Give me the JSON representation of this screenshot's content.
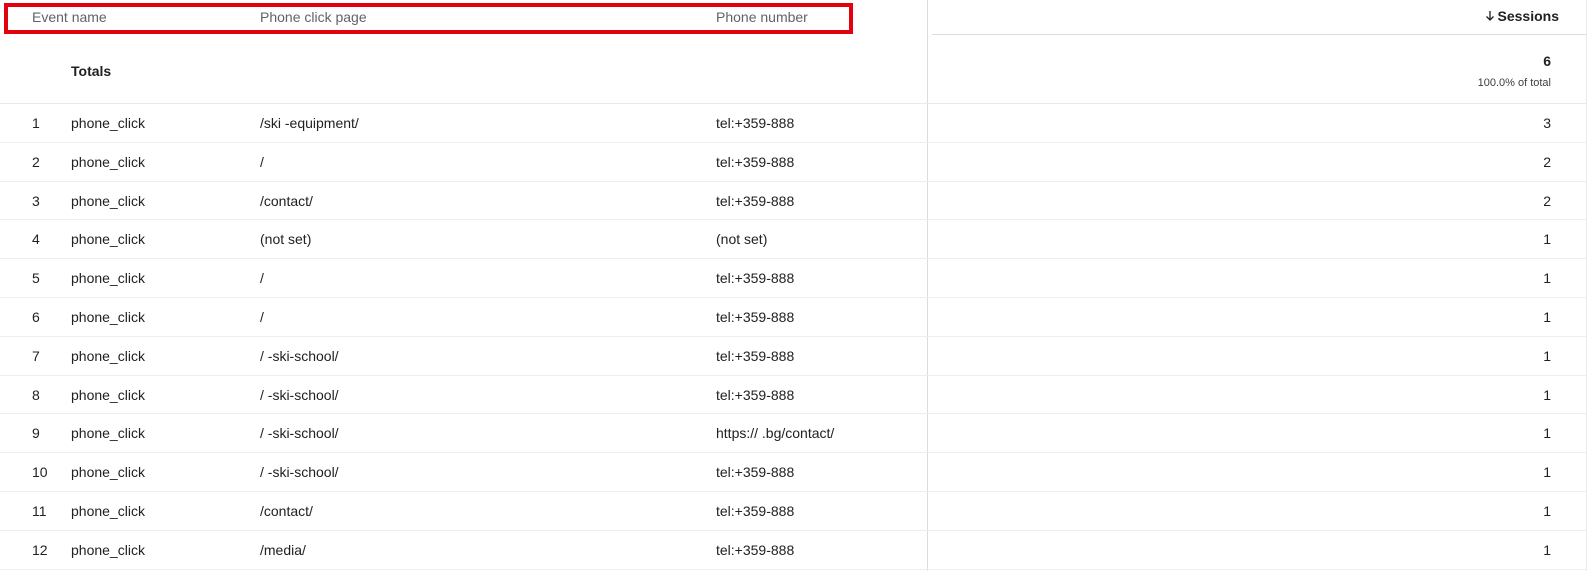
{
  "header": {
    "event_name": "Event name",
    "phone_click_page": "Phone click page",
    "phone_number": "Phone number",
    "sessions": "Sessions",
    "sort_icon": "arrow-down-icon"
  },
  "totals": {
    "label": "Totals",
    "value": "6",
    "percent": "100.0% of total"
  },
  "rows": [
    {
      "index": "1",
      "event": "phone_click",
      "page": "/ski              -equipment/",
      "phone": "tel:+359-888",
      "sessions": "3"
    },
    {
      "index": "2",
      "event": "phone_click",
      "page": "/",
      "phone": "tel:+359-888",
      "sessions": "2"
    },
    {
      "index": "3",
      "event": "phone_click",
      "page": "/contact/",
      "phone": "tel:+359-888",
      "sessions": "2"
    },
    {
      "index": "4",
      "event": "phone_click",
      "page": "(not set)",
      "phone": "(not set)",
      "sessions": "1"
    },
    {
      "index": "5",
      "event": "phone_click",
      "page": "/",
      "phone": "tel:+359-888",
      "sessions": "1"
    },
    {
      "index": "6",
      "event": "phone_click",
      "page": "/",
      "phone": "tel:+359-888",
      "sessions": "1"
    },
    {
      "index": "7",
      "event": "phone_click",
      "page": "/              -ski-school/",
      "phone": "tel:+359-888",
      "sessions": "1"
    },
    {
      "index": "8",
      "event": "phone_click",
      "page": "/              -ski-school/",
      "phone": "tel:+359-888",
      "sessions": "1"
    },
    {
      "index": "9",
      "event": "phone_click",
      "page": "/              -ski-school/",
      "phone": "https://              .bg/contact/",
      "sessions": "1"
    },
    {
      "index": "10",
      "event": "phone_click",
      "page": "/              -ski-school/",
      "phone": "tel:+359-888",
      "sessions": "1"
    },
    {
      "index": "11",
      "event": "phone_click",
      "page": "/contact/",
      "phone": "tel:+359-888",
      "sessions": "1"
    },
    {
      "index": "12",
      "event": "phone_click",
      "page": "/media/",
      "phone": "tel:+359-888",
      "sessions": "1"
    }
  ],
  "colors": {
    "highlight": "#e3000f",
    "text": "#202124",
    "muted": "#5f6368"
  }
}
